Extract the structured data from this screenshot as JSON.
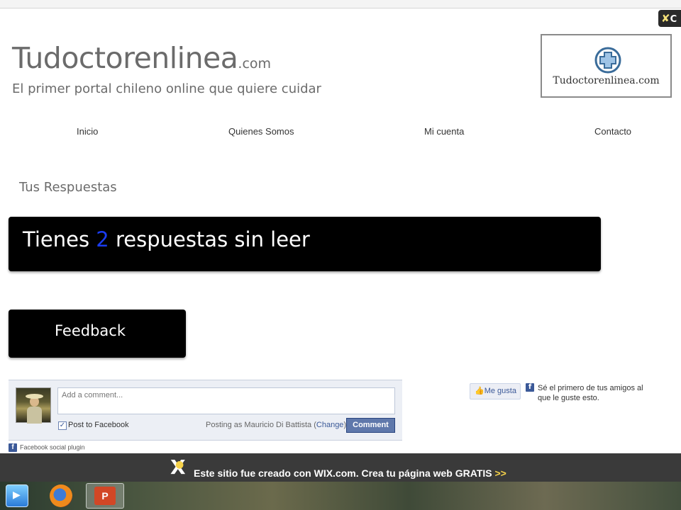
{
  "site": {
    "title_main": "Tudoctorenlinea",
    "title_tld": ".com",
    "tagline": "El primer portal chileno online que quiere cuidar",
    "logo_text": "Tudoctorenlinea.com"
  },
  "wix_corner": {
    "label": "C"
  },
  "nav": {
    "items": [
      {
        "label": "Inicio"
      },
      {
        "label": "Quienes Somos"
      },
      {
        "label": "Mi cuenta"
      },
      {
        "label": "Contacto"
      }
    ]
  },
  "main": {
    "section_title": "Tus Respuestas",
    "unread_prefix": "Tienes ",
    "unread_count": "2",
    "unread_suffix": " respuestas sin leer",
    "feedback_label": "Feedback"
  },
  "facebook": {
    "comment_placeholder": "Add a comment...",
    "post_to_facebook": "Post to Facebook",
    "post_checked": "✓",
    "posting_as_prefix": "Posting as Mauricio Di Battista (",
    "change_label": "Change",
    "posting_as_suffix": ")",
    "comment_button": "Comment",
    "social_plugin": "Facebook social plugin",
    "like_button": "Me gusta",
    "like_text": "Sé el primero de tus amigos al que le guste esto."
  },
  "wix_footer": {
    "text": "Este sitio fue creado con WIX.com. Crea tu página web GRATIS",
    "arrows": ">>"
  },
  "taskbar": {
    "ppt_glyph": "P"
  },
  "colors": {
    "banner_bg": "#000000",
    "unread_count": "#1a3cf0",
    "fb_blue": "#3b5998",
    "wix_yellow": "#f6d24a",
    "footer_bg": "#3a3a3a"
  }
}
